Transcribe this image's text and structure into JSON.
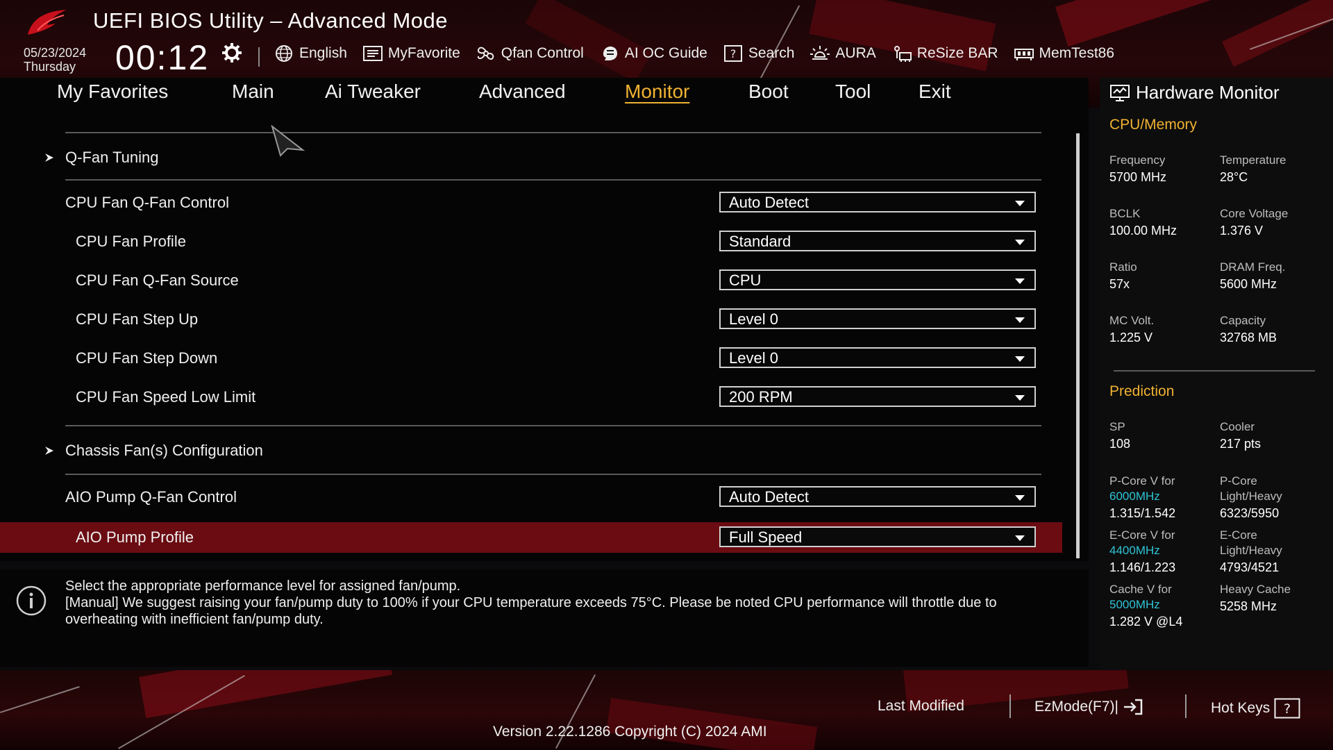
{
  "header": {
    "title": "UEFI BIOS Utility – Advanced Mode",
    "date": "05/23/2024",
    "weekday": "Thursday",
    "time": "00:12",
    "toolbar": [
      {
        "label": "English",
        "icon": "globe-icon"
      },
      {
        "label": "MyFavorite",
        "icon": "favorite-list-icon"
      },
      {
        "label": "Qfan Control",
        "icon": "fan-icon"
      },
      {
        "label": "AI OC Guide",
        "icon": "ai-oc-guide-icon"
      },
      {
        "label": "Search",
        "icon": "search-help-icon"
      },
      {
        "label": "AURA",
        "icon": "aura-light-icon"
      },
      {
        "label": "ReSize BAR",
        "icon": "resize-bar-icon"
      },
      {
        "label": "MemTest86",
        "icon": "memory-icon"
      }
    ]
  },
  "tabs": [
    "My Favorites",
    "Main",
    "Ai Tweaker",
    "Advanced",
    "Monitor",
    "Boot",
    "Tool",
    "Exit"
  ],
  "active_tab": "Monitor",
  "settings": {
    "qfan_tuning": "Q-Fan Tuning",
    "chassis_config": "Chassis Fan(s) Configuration",
    "rows": [
      {
        "label": "CPU Fan Q-Fan Control",
        "value": "Auto Detect"
      },
      {
        "label": "CPU Fan Profile",
        "value": "Standard"
      },
      {
        "label": "CPU Fan Q-Fan Source",
        "value": "CPU"
      },
      {
        "label": "CPU Fan Step Up",
        "value": "Level 0"
      },
      {
        "label": "CPU Fan Step Down",
        "value": "Level 0"
      },
      {
        "label": "CPU Fan Speed Low Limit",
        "value": "200 RPM"
      },
      {
        "label": "AIO Pump Q-Fan Control",
        "value": "Auto Detect"
      },
      {
        "label": "AIO Pump Profile",
        "value": "Full Speed"
      }
    ],
    "selected_row": "AIO Pump Profile"
  },
  "help": {
    "line1": "Select the appropriate performance level for assigned fan/pump.",
    "line2": "[Manual] We suggest raising your fan/pump duty to 100% if your CPU temperature exceeds 75°C. Please be noted CPU performance will throttle due to overheating with inefficient fan/pump duty."
  },
  "hardware_monitor": {
    "title": "Hardware Monitor",
    "cpu_memory": {
      "heading": "CPU/Memory",
      "frequency_label": "Frequency",
      "frequency": "5700 MHz",
      "temperature_label": "Temperature",
      "temperature": "28°C",
      "bclk_label": "BCLK",
      "bclk": "100.00 MHz",
      "core_voltage_label": "Core Voltage",
      "core_voltage": "1.376 V",
      "ratio_label": "Ratio",
      "ratio": "57x",
      "dram_freq_label": "DRAM Freq.",
      "dram_freq": "5600 MHz",
      "mc_volt_label": "MC Volt.",
      "mc_volt": "1.225 V",
      "capacity_label": "Capacity",
      "capacity": "32768 MB"
    },
    "prediction": {
      "heading": "Prediction",
      "sp_label": "SP",
      "sp": "108",
      "cooler_label": "Cooler",
      "cooler": "217 pts",
      "pcore_v_label": "P-Core V for",
      "pcore_v_freq": "6000MHz",
      "pcore_v": "1.315/1.542",
      "pcore_lh_label1": "P-Core",
      "pcore_lh_label2": "Light/Heavy",
      "pcore_lh": "6323/5950",
      "ecore_v_label": "E-Core V for",
      "ecore_v_freq": "4400MHz",
      "ecore_v": "1.146/1.223",
      "ecore_lh_label1": "E-Core",
      "ecore_lh_label2": "Light/Heavy",
      "ecore_lh": "4793/4521",
      "cache_v_label": "Cache V for",
      "cache_v_freq": "5000MHz",
      "cache_v": "1.282 V @L4",
      "heavy_cache_label": "Heavy Cache",
      "heavy_cache": "5258 MHz"
    }
  },
  "footer": {
    "last_modified": "Last Modified",
    "ezmode": "EzMode(F7)|",
    "hot_keys": "Hot Keys",
    "version": "Version 2.22.1286 Copyright (C) 2024 AMI"
  },
  "colors": {
    "accent": "#f0b232",
    "selected_row": "#6a0c12",
    "cyan_accent": "#2ec4d6",
    "brand_red": "#c8101c"
  }
}
